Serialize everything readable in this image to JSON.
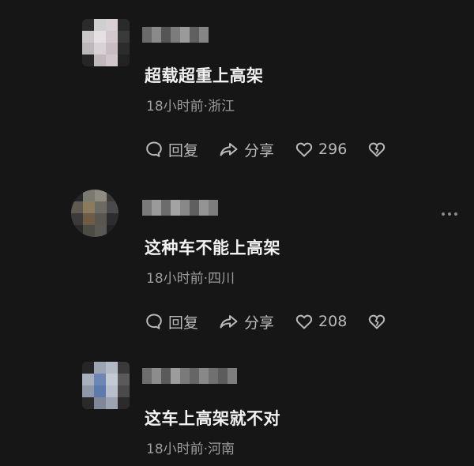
{
  "comments": [
    {
      "text": "超载超重上高架",
      "meta": "18小时前·浙江",
      "reply_label": "回复",
      "share_label": "分享",
      "like_count": "296",
      "avatar_colors": [
        "#2b2b2b",
        "#cfcfcf",
        "#d9d0d6",
        "#2a2a2a",
        "#cbc6c8",
        "#e6dfe3",
        "#d4c8cf",
        "#3a3a3a",
        "#bdb6ba",
        "#d8d1d6",
        "#c9bdc4",
        "#2c2c2c",
        "#262626",
        "#bfb9bc",
        "#cfc7cc",
        "#232323"
      ],
      "username_colors": [
        "#6a6a6a",
        "#8a8a8a",
        "#555555",
        "#7c7c7c",
        "#9a9a9a",
        "#606060",
        "#858585"
      ]
    },
    {
      "text": "这种车不能上高架",
      "meta": "18小时前·四川",
      "reply_label": "回复",
      "share_label": "分享",
      "like_count": "208",
      "avatar_colors": [
        "#262626",
        "#7a7a72",
        "#8f8b80",
        "#3a3a3a",
        "#5e5a52",
        "#8c7a5c",
        "#6d6a64",
        "#4a4a4a",
        "#3b3b3b",
        "#6e5c46",
        "#58574f",
        "#2d2d2d",
        "#2a2a2a",
        "#4d4b45",
        "#5a5852",
        "#222222"
      ],
      "username_colors": [
        "#7a7a7a",
        "#9a9a9a",
        "#6c6c6c",
        "#a3a3a3",
        "#888888",
        "#5f5f5f",
        "#949494",
        "#7d7d7d"
      ]
    },
    {
      "text": "这车上高架就不对",
      "meta": "18小时前·河南",
      "avatar_colors": [
        "#262626",
        "#9aa4b3",
        "#b3bac6",
        "#3a3a3a",
        "#a8b0bd",
        "#6e86b5",
        "#c4cad4",
        "#5a5a5a",
        "#8e98a8",
        "#5e79ac",
        "#b8bfca",
        "#4a4a4a",
        "#2a2a2a",
        "#7f8898",
        "#9ca4b2",
        "#2b2b2b"
      ],
      "username_colors": [
        "#6e6e6e",
        "#8c8c8c",
        "#5a5a5a",
        "#9c9c9c",
        "#7a7a7a",
        "#666666",
        "#888888",
        "#707070",
        "#5c5c5c",
        "#7e7e7e"
      ]
    }
  ],
  "icons": {
    "reply": "comment-bubble-icon",
    "share": "share-arrow-icon",
    "like": "heart-icon",
    "dislike": "broken-heart-icon",
    "more": "more-dots-icon"
  }
}
